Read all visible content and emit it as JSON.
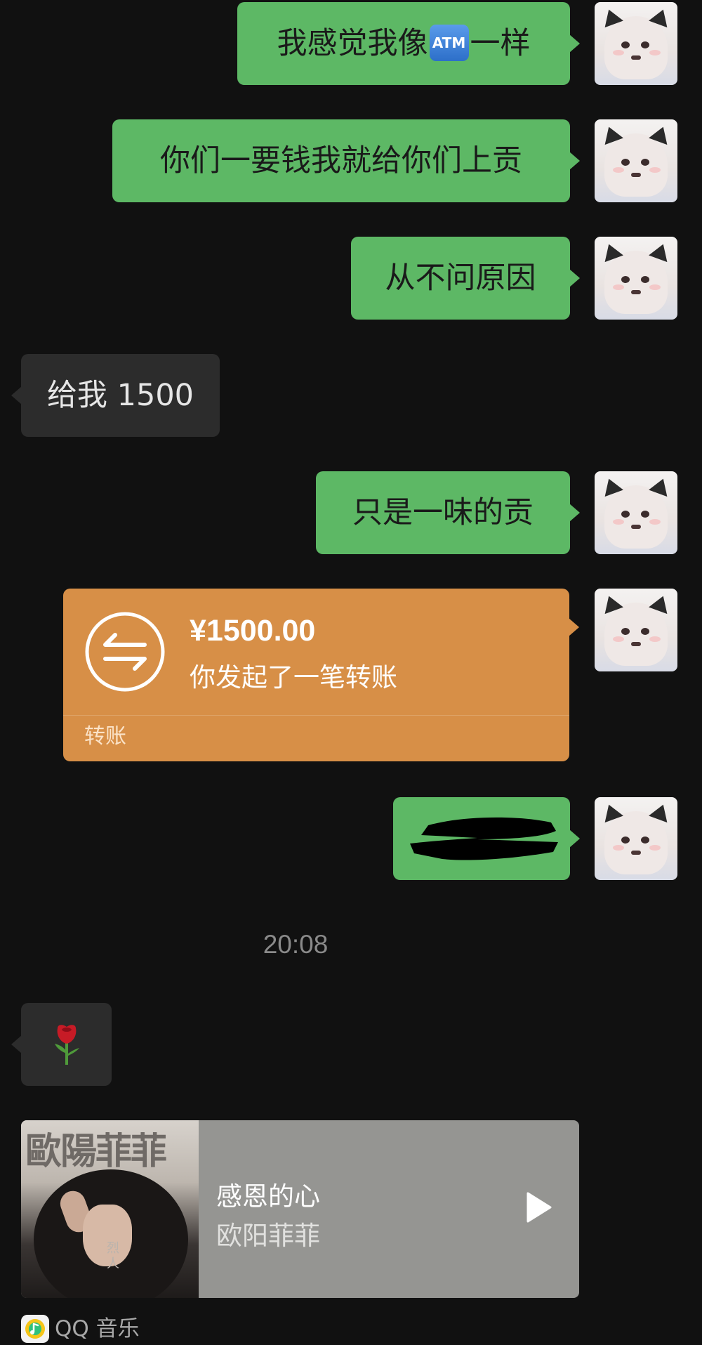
{
  "messages": [
    {
      "side": "out",
      "text_before": "我感觉我像",
      "emoji": "ATM",
      "text_after": "一样"
    },
    {
      "side": "out",
      "text": "你们一要钱我就给你们上贡"
    },
    {
      "side": "out",
      "text": "从不问原因"
    },
    {
      "side": "in",
      "text": "给我 1500"
    },
    {
      "side": "out",
      "text": "只是一味的贡"
    }
  ],
  "transfer": {
    "amount": "¥1500.00",
    "description": "你发起了一笔转账",
    "label": "转账",
    "color": "#d78f47"
  },
  "redacted_message": {
    "side": "out",
    "note": ""
  },
  "timestamp": "20:08",
  "rose_message": {
    "side": "in",
    "icon": "rose-icon"
  },
  "music_card": {
    "album_title": "歐陽菲菲",
    "album_caption": "烈 人",
    "song_title": "感恩的心",
    "artist": "欧阳菲菲",
    "source": "QQ 音乐"
  },
  "colors": {
    "background": "#111111",
    "outgoing_bubble": "#5db865",
    "incoming_bubble": "#2c2c2c",
    "music_card": "#959592"
  }
}
